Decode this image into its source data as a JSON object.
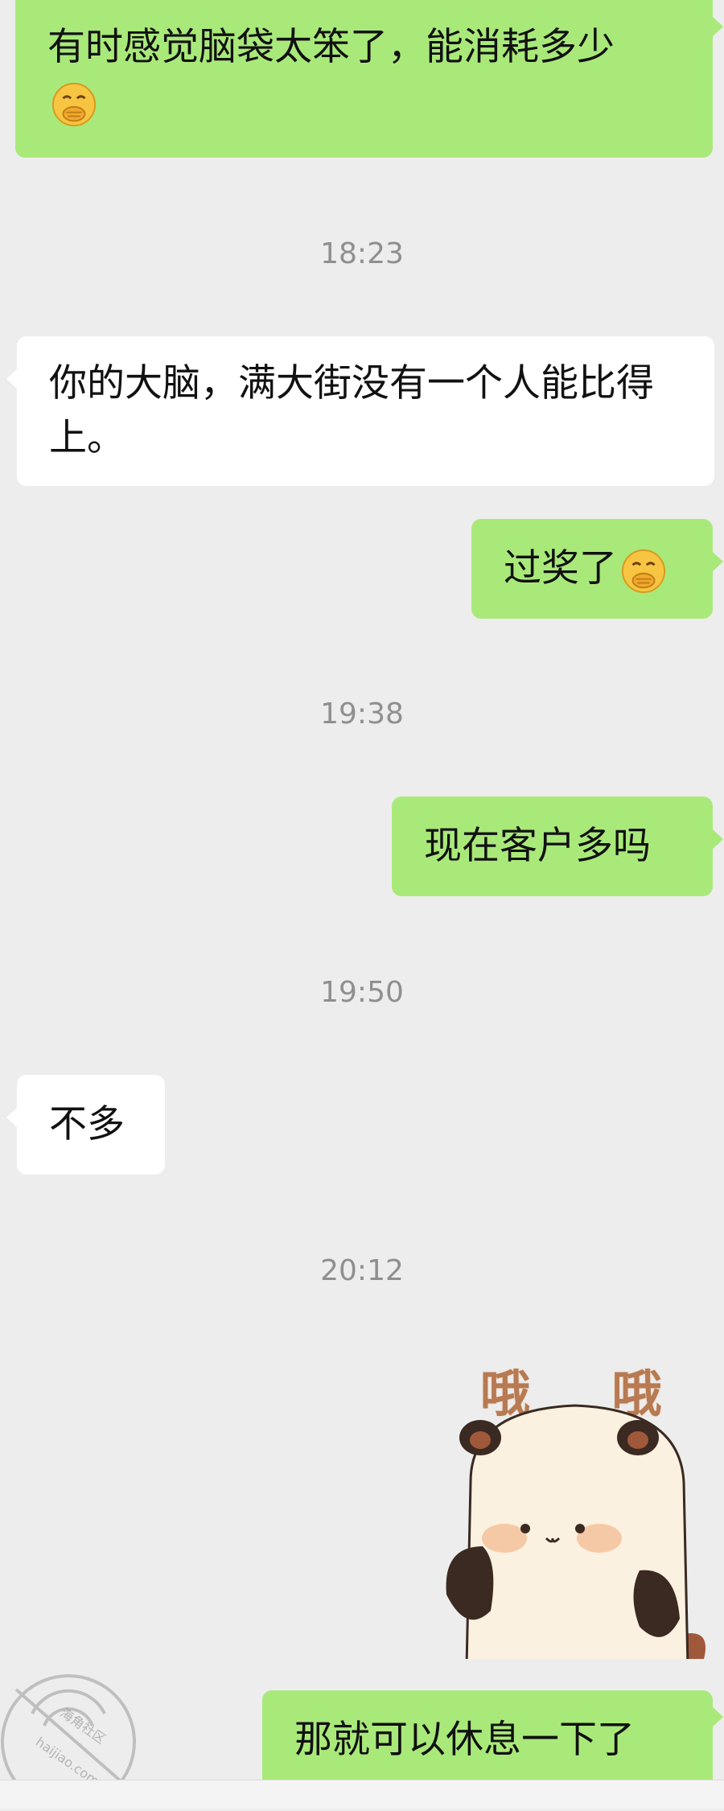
{
  "messages": [
    {
      "id": "m1",
      "side": "out",
      "text": "有时感觉脑袋太笨了，能消耗多少",
      "emoji": "face-with-hand-over-mouth"
    },
    {
      "id": "m2",
      "side": "in",
      "text": "你的大脑，满大街没有一个人能比得上。"
    },
    {
      "id": "m3",
      "side": "out",
      "text": "过奖了",
      "emoji": "face-with-hand-over-mouth"
    },
    {
      "id": "m4",
      "side": "out",
      "text": "现在客户多吗"
    },
    {
      "id": "m5",
      "side": "in",
      "text": "不多"
    },
    {
      "id": "m6",
      "side": "out",
      "text": "那就可以休息一下了"
    }
  ],
  "timestamps": [
    "18:23",
    "19:38",
    "19:50",
    "20:12"
  ],
  "sticker": {
    "text": "哦 哦",
    "icon": "panda-sticker"
  },
  "watermark": {
    "line1": "海角社区",
    "line2": "haijiao.com"
  },
  "colors": {
    "background": "#ededed",
    "outgoing_bubble": "#a9e97a",
    "incoming_bubble": "#ffffff",
    "timestamp": "#8f8f8f"
  }
}
